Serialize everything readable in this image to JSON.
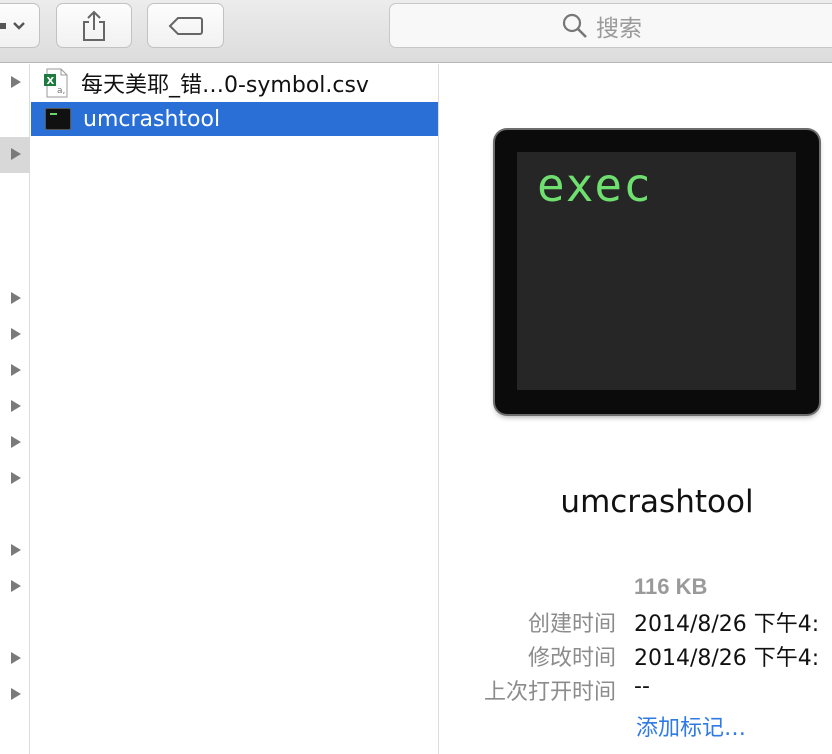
{
  "toolbar": {
    "search_placeholder": "搜索",
    "action_icon": "gear-dropdown-icon",
    "share_icon": "share-icon",
    "tags_icon": "tag-icon"
  },
  "file_list": {
    "items": [
      {
        "name": "每天美耶_错…0-symbol.csv",
        "icon": "excel-csv-icon",
        "selected": false
      },
      {
        "name": "umcrashtool",
        "icon": "unix-executable-icon",
        "selected": true
      }
    ]
  },
  "preview": {
    "icon_text": "exec",
    "name": "umcrashtool",
    "size": "116 KB",
    "created_label": "创建时间",
    "created_value": "2014/8/26 下午4:",
    "modified_label": "修改时间",
    "modified_value": "2014/8/26 下午4:",
    "last_opened_label": "上次打开时间",
    "last_opened_value": "--",
    "add_tags": "添加标记…"
  },
  "colors": {
    "selection": "#2a6fd6",
    "link": "#2f7ae5",
    "terminal_green": "#6fe06f"
  }
}
